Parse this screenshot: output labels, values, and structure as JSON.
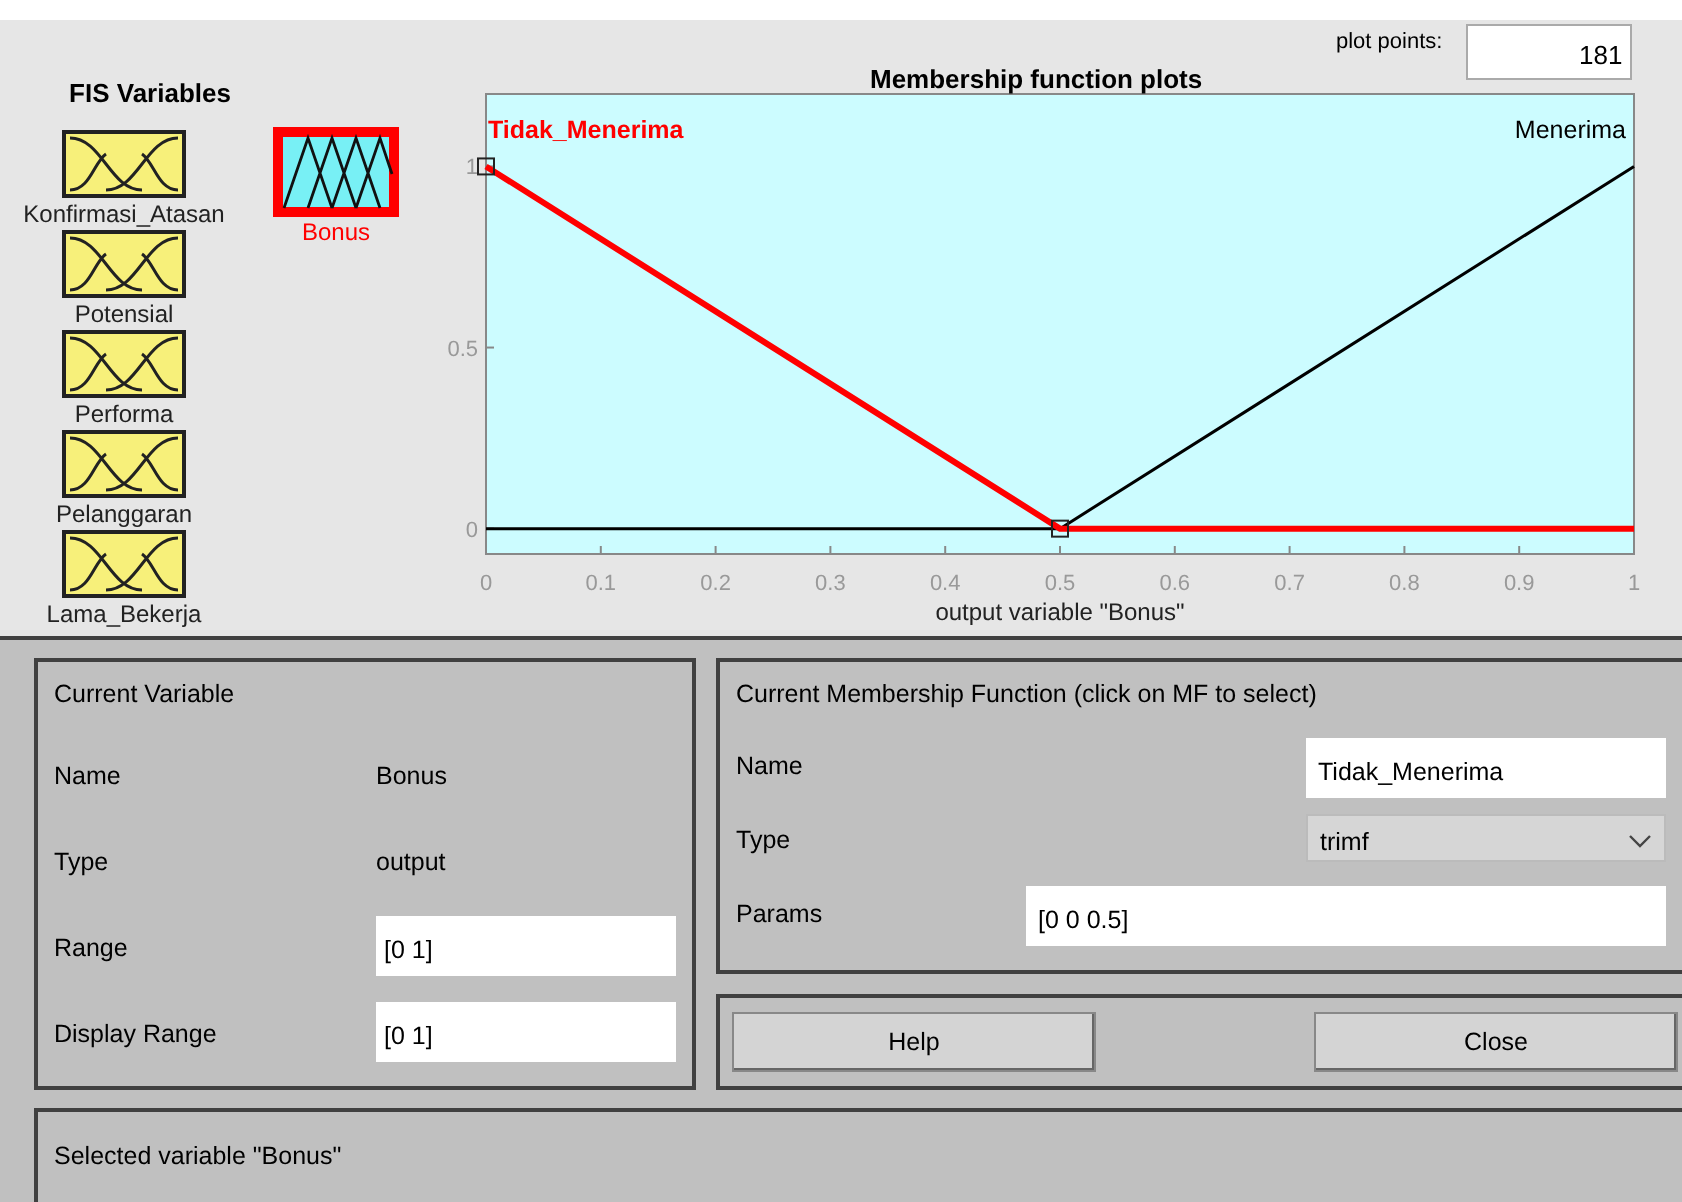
{
  "fis_variables": {
    "title": "FIS Variables",
    "items": [
      {
        "name": "Konfirmasi_Atasan",
        "kind": "input",
        "selected": false
      },
      {
        "name": "Bonus",
        "kind": "output",
        "selected": true
      },
      {
        "name": "Potensial",
        "kind": "input",
        "selected": false
      },
      {
        "name": "Performa",
        "kind": "input",
        "selected": false
      },
      {
        "name": "Pelanggaran",
        "kind": "input",
        "selected": false
      },
      {
        "name": "Lama_Bekerja",
        "kind": "input",
        "selected": false
      }
    ]
  },
  "plot": {
    "plot_points_label": "plot points:",
    "plot_points": "181",
    "chart_data": {
      "type": "line",
      "title": "Membership function plots",
      "xlabel": "output variable \"Bonus\"",
      "x": [
        0,
        0.5,
        1
      ],
      "series": [
        {
          "name": "Tidak_Menerima",
          "color": "#ff0000",
          "values": [
            1,
            0,
            0
          ]
        },
        {
          "name": "Menerima",
          "color": "#000000",
          "values": [
            0,
            0,
            1
          ]
        }
      ],
      "xlim": [
        0,
        1
      ],
      "ylim": [
        -0.07,
        1.2
      ],
      "xticks": [
        0,
        {
          "value": 0.1,
          "label": "0.1"
        },
        {
          "value": 0.2,
          "label": "0.2"
        },
        {
          "value": 0.3,
          "label": "0.3"
        },
        {
          "value": 0.4,
          "label": "0.4"
        },
        {
          "value": 0.5,
          "label": "0.5"
        },
        {
          "value": 0.6,
          "label": "0.6"
        },
        {
          "value": 0.7,
          "label": "0.7"
        },
        {
          "value": 0.8,
          "label": "0.8"
        },
        {
          "value": 0.9,
          "label": "0.9"
        },
        1
      ],
      "yticks": [
        0,
        {
          "value": 0.5,
          "label": "0.5"
        },
        1
      ]
    }
  },
  "current_variable": {
    "title": "Current Variable",
    "name_label": "Name",
    "name": "Bonus",
    "type_label": "Type",
    "type": "output",
    "range_label": "Range",
    "range": "[0 1]",
    "display_range_label": "Display Range",
    "display_range": "[0 1]"
  },
  "current_mf": {
    "title": "Current Membership Function (click on MF to select)",
    "name_label": "Name",
    "name": "Tidak_Menerima",
    "type_label": "Type",
    "type": "trimf",
    "params_label": "Params",
    "params": "[0 0 0.5]"
  },
  "buttons": [
    "Help",
    "Close"
  ],
  "status_bar": "Selected variable \"Bonus\""
}
